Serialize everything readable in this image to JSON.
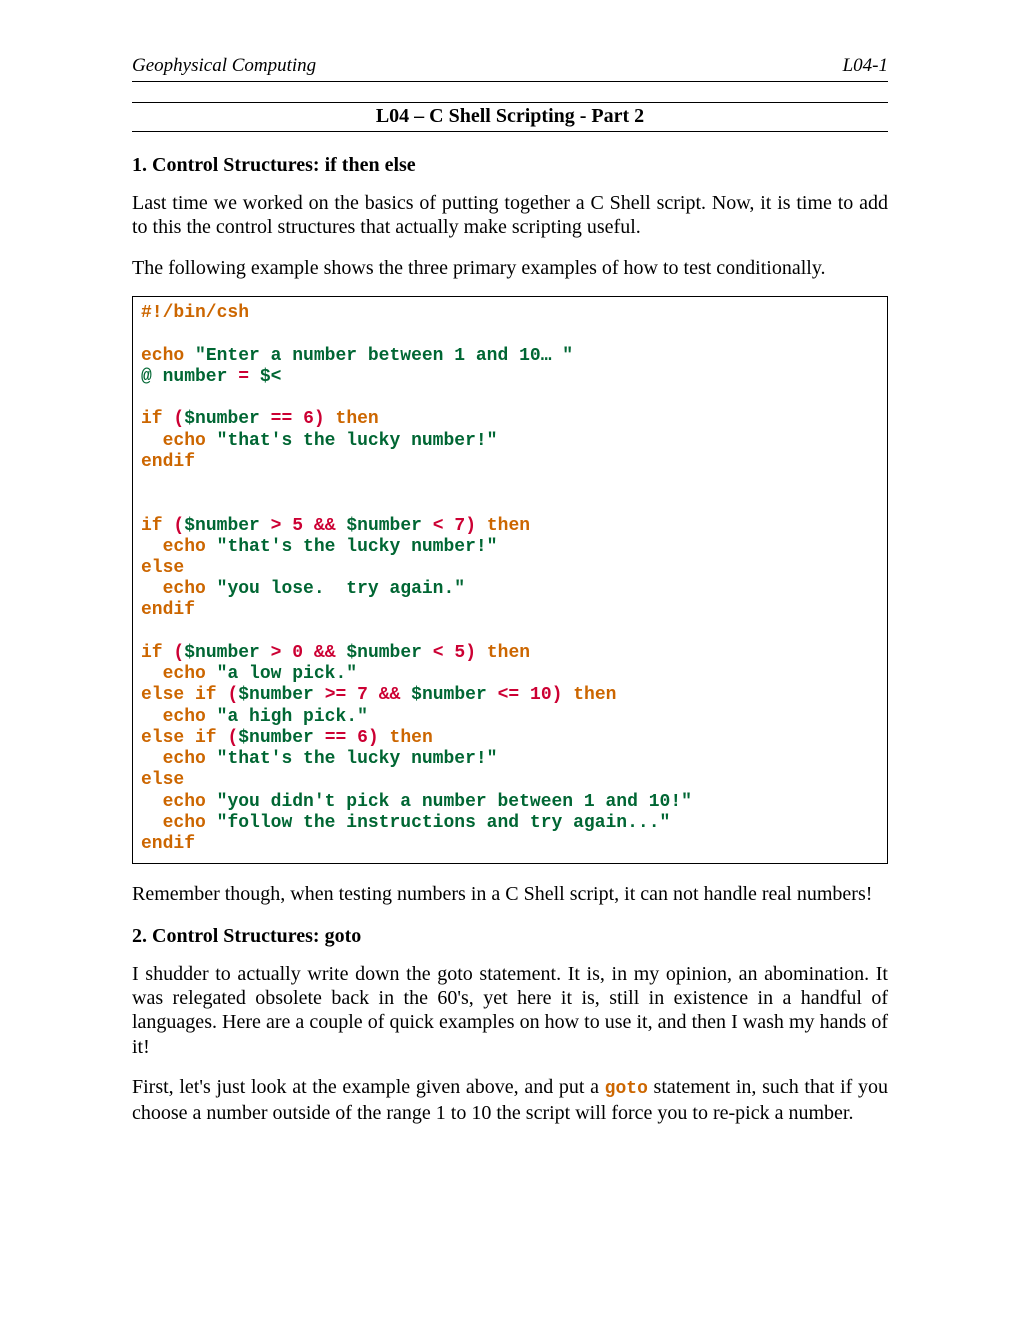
{
  "header": {
    "left": "Geophysical Computing",
    "right": "L04-1"
  },
  "title": "L04 – C Shell Scripting - Part 2",
  "s1": {
    "heading": "1. Control Structures:  if then else",
    "p1": "Last time we worked on the basics of putting together a C Shell script.  Now, it is time to add to this the control structures that actually make scripting useful.",
    "p2": "The following example shows the three primary examples of how to test conditionally."
  },
  "code": {
    "shebang": "#!/bin/csh",
    "prompt_str": "\"Enter a number between 1 and 10… \"",
    "assign_lhs": "@ number ",
    "assign_rhs": " $<",
    "n6": "6",
    "n5": "5",
    "n7": "7",
    "n0": "0",
    "n10": "10",
    "lucky": "\"that's the lucky number!\"",
    "lose": "\"you lose.  try again.\"",
    "low": "\"a low pick.\"",
    "high": "\"a high pick.\"",
    "bad1": "\"you didn't pick a number between 1 and 10!\"",
    "bad2": "\"follow the instructions and try again...\"",
    "var_num": "$number",
    "kw_echo": "echo",
    "kw_if": "if",
    "kw_then": "then",
    "kw_else": "else",
    "kw_elseif": "else if",
    "kw_endif": "endif",
    "op_eqeq": "==",
    "op_gt": ">",
    "op_lt": "<",
    "op_ge": ">=",
    "op_le": "<=",
    "op_and": "&&",
    "op_eq": "=",
    "lp": "(",
    "rp": ")"
  },
  "mid": {
    "p": "Remember though, when testing numbers in a C Shell script, it can not handle real numbers!"
  },
  "s2": {
    "heading": "2. Control Structures:  goto",
    "p1": "I shudder to actually write down the goto statement.  It is, in my opinion, an abomination.  It was relegated obsolete back in the 60's, yet here it is, still in existence in a handful of languages.  Here are a couple of quick examples on how to use it, and then I wash my hands of it!",
    "p2a": "First, let's just look at the example given above, and put a ",
    "goto": "goto",
    "p2b": " statement in, such that if you choose a number outside of the range 1 to 10 the script will force you to re-pick a number."
  }
}
